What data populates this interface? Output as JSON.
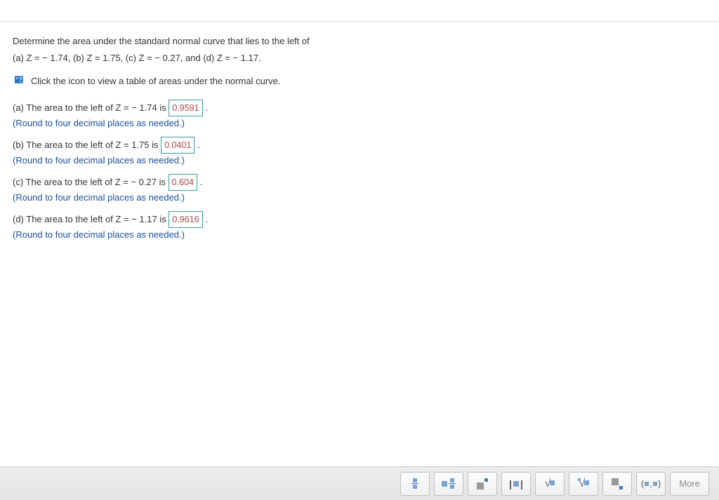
{
  "question": {
    "line1": "Determine the area under the standard normal curve that lies to the left of",
    "line2": "(a) Z = − 1.74, (b) Z = 1.75, (c) Z = − 0.27, and (d) Z = − 1.17."
  },
  "icon_hint": "Click the icon to view a table of areas under the normal curve.",
  "parts": {
    "a": {
      "prefix": "(a) The area to the left of Z = − 1.74 is ",
      "answer": "0.9591",
      "suffix": ".",
      "hint": "(Round to four decimal places as needed.)"
    },
    "b": {
      "prefix": "(b) The area to the left of Z = 1.75 is ",
      "answer": "0.0401",
      "suffix": ".",
      "hint": "(Round to four decimal places as needed.)"
    },
    "c": {
      "prefix": "(c) The area to the left of Z = − 0.27 is ",
      "answer": "0.604",
      "suffix": ".",
      "hint": "(Round to four decimal places as needed.)"
    },
    "d": {
      "prefix": "(d) The area to the left of Z = − 1.17 is ",
      "answer": "0.9616",
      "suffix": ".",
      "hint": "(Round to four decimal places as needed.)"
    }
  },
  "toolbar": {
    "more_label": "More"
  }
}
